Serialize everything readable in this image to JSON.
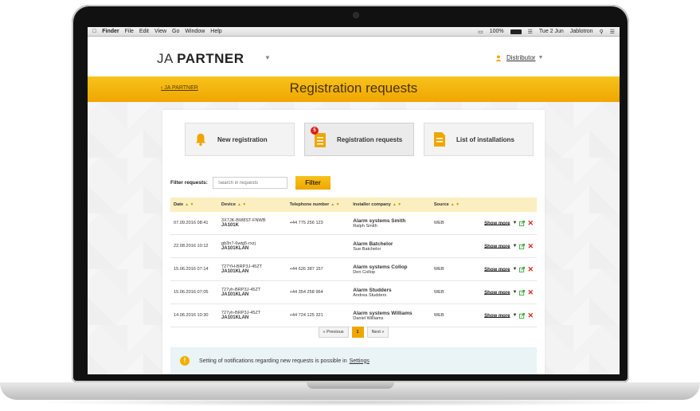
{
  "menubar": {
    "apple": "",
    "app": "Finder",
    "items": [
      "File",
      "Edit",
      "View",
      "Go",
      "Window",
      "Help"
    ],
    "battery": "100%",
    "datetime": "Tue 2 Jun",
    "user": "Jablotron"
  },
  "header": {
    "logo_thin": "JA",
    "logo_bold": "PARTNER",
    "user_role": "Distributor"
  },
  "band": {
    "breadcrumb": "‹ JA PARTNER",
    "title": "Registration requests"
  },
  "tiles": [
    {
      "label": "New registration"
    },
    {
      "label": "Registration requests",
      "badge": "5"
    },
    {
      "label": "List of installations"
    }
  ],
  "filter": {
    "label": "Filter requests:",
    "placeholder": "Search in requests",
    "button": "Filter"
  },
  "table": {
    "headers": [
      "Date",
      "Device",
      "Telephone number",
      "Installer company",
      "Source"
    ],
    "rows": [
      {
        "date": "07.09.2016 08:41",
        "device_id": "3X7JK-BW8ST-FNWB",
        "device_model": "JA101K",
        "phone": "+44 775 256 123",
        "company": "Alarm systems Smith",
        "person": "Ralph Smith",
        "source": "WEB",
        "action": "Show more"
      },
      {
        "date": "22.08.2016 10:12",
        "device_id": "gb3n7-6wtg5-rxzj",
        "device_model": "JA101KLAN",
        "phone": "",
        "company": "Alarm Batchelor",
        "person": "Sue Batchelor",
        "source": "",
        "action": "Show more"
      },
      {
        "date": "15.06.2016 07:14",
        "device_id": "727YH-BRP3J-45ZT",
        "device_model": "JA101KLAN",
        "phone": "+44 626 387 157",
        "company": "Alarm systems Collop",
        "person": "Den Collop",
        "source": "WEB",
        "action": "Show more"
      },
      {
        "date": "15.06.2016 07:05",
        "device_id": "727yh-BRP3J-45ZT",
        "device_model": "JA101KLAN",
        "phone": "+44 354 258 964",
        "company": "Alarm Studders",
        "person": "Andrea Studders",
        "source": "WEB",
        "action": "Show more"
      },
      {
        "date": "14.06.2016 10:30",
        "device_id": "727yh-BRP3J-45ZT",
        "device_model": "JA101KLAN",
        "phone": "+44 724 125 321",
        "company": "Alarm systems Williams",
        "person": "Daniel Williams",
        "source": "WEB",
        "action": "Show more"
      }
    ]
  },
  "pager": {
    "prev": "« Previous",
    "current": "1",
    "next": "Next »"
  },
  "notice": {
    "text": "Setting of notifications regarding new requests is possible in",
    "link": "Settings"
  },
  "colors": {
    "accent": "#f0a600",
    "header_row": "#fbeec0",
    "delete": "#d9231d",
    "export": "#3aa53a",
    "notice_bg": "#eaf3f5"
  }
}
